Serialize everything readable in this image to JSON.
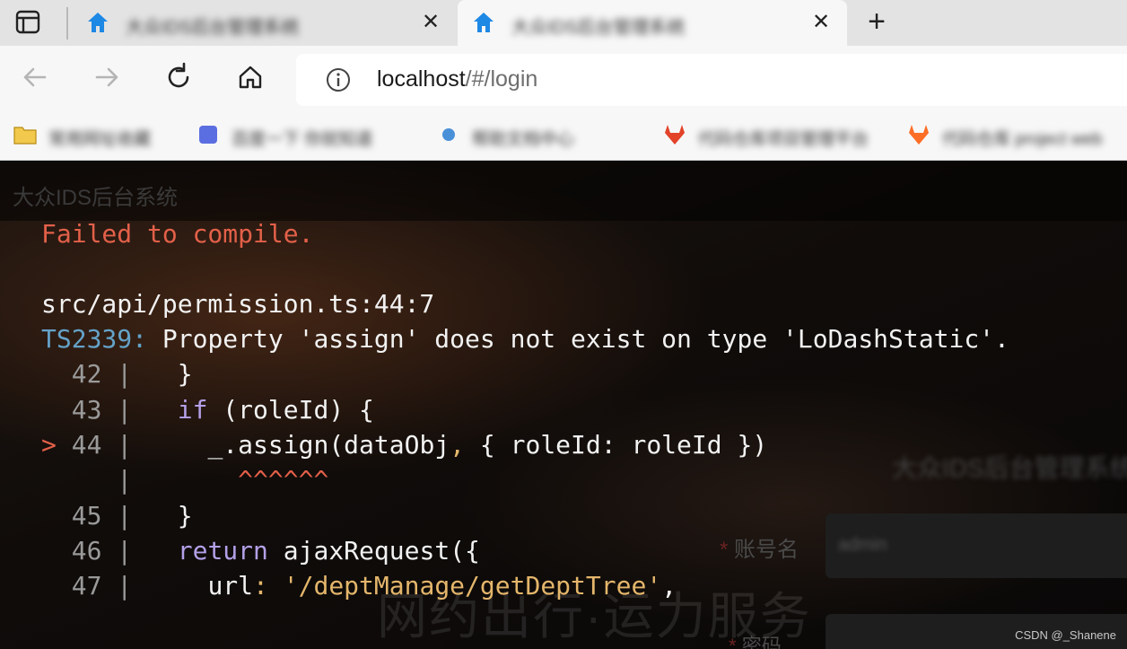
{
  "browser": {
    "tabs": [
      {
        "title": "大众IDS后台管理系统"
      },
      {
        "title": "大众IDS后台管理系统"
      }
    ],
    "newtab_label": "+",
    "close_glyph": "✕",
    "address": {
      "host": "localhost",
      "path": "/#/login"
    },
    "bookmarks": [
      {
        "label": "常用网址收藏",
        "icon": "folder-icon",
        "color": "#f2c94c"
      },
      {
        "label": "百度一下 你就知道",
        "icon": "app-icon",
        "color": "#5b6ee1"
      },
      {
        "label": "帮助文档中心",
        "icon": "link-icon",
        "color": "#4a90d9"
      },
      {
        "label": "代码仓库项目管理平台",
        "icon": "gitlab-icon",
        "color": "#e24329"
      },
      {
        "label": "代码仓库 project web",
        "icon": "gitlab-icon",
        "color": "#e24329"
      }
    ]
  },
  "app": {
    "title": "大众IDS后台系统",
    "slogan": "网约出行·运力服务",
    "login": {
      "title": "大众IDS后台管理系统",
      "account_label": "账号名",
      "account_value": "admin",
      "password_label": "密码",
      "required_mark": "*"
    }
  },
  "error": {
    "title": "Failed to compile.",
    "file": "src/api/permission.ts:44:7",
    "code": "TS2339",
    "message": " Property 'assign' does not exist on type 'LoDashStatic'.",
    "marker": ">",
    "pipe": "|",
    "carets": "^^^^^^",
    "lines": [
      {
        "num": "42",
        "text": "}"
      },
      {
        "num": "43",
        "kw": "if",
        "text": " (roleId) {"
      },
      {
        "num": "44",
        "text": "_.assign(dataObj",
        "comma": ",",
        "rest": " { roleId: roleId })"
      },
      {
        "num": "45",
        "text": "}"
      },
      {
        "num": "46",
        "kw": "return",
        "text": " ajaxRequest({"
      },
      {
        "num": "47",
        "text": "url",
        "colon": ":",
        "str": "'/deptManage/getDeptTree'",
        "comma": ","
      }
    ]
  },
  "watermark": "CSDN @_Shanene"
}
